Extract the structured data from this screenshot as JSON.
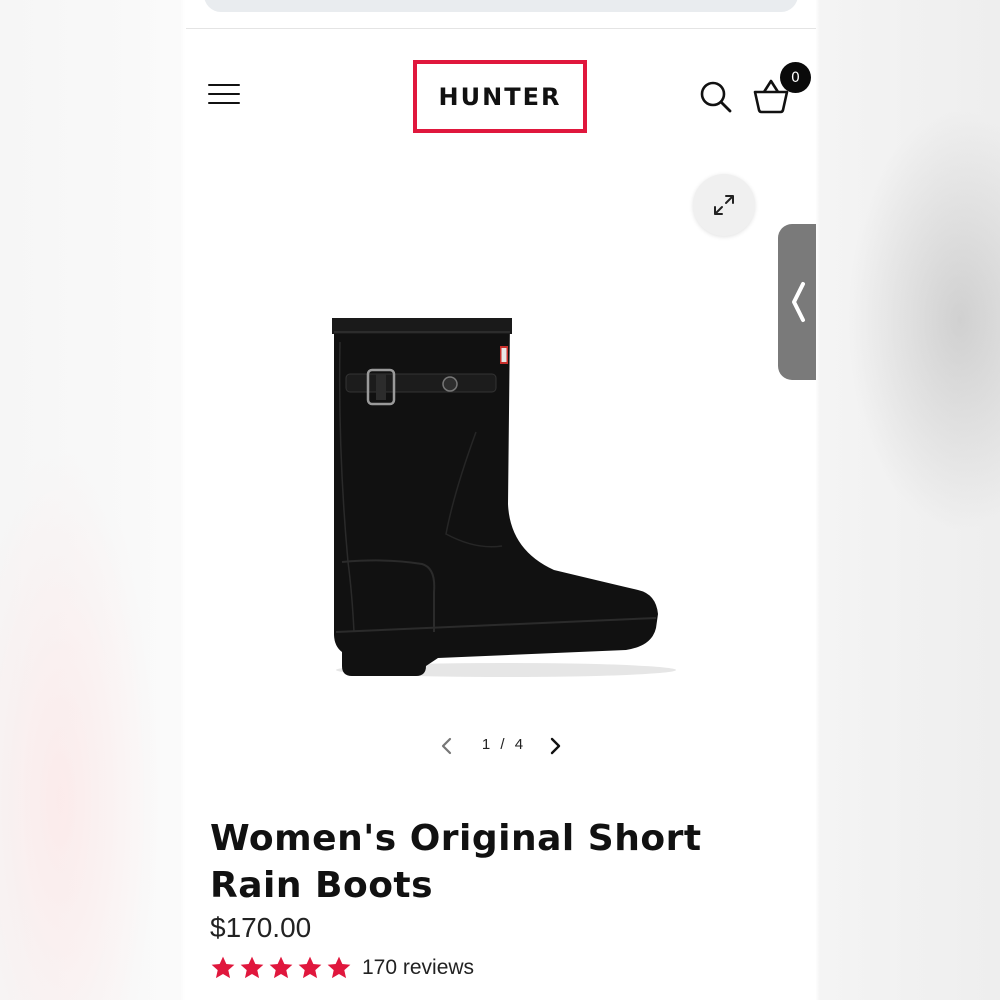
{
  "brand": {
    "logo_text": "HUNTER",
    "accent_color": "#e0173d"
  },
  "header": {
    "menu_icon": "hamburger-menu-icon",
    "search_icon": "search-icon",
    "cart_icon": "basket-icon",
    "cart_count": "0"
  },
  "gallery": {
    "expand_icon": "expand-icon",
    "side_tab_icon": "chevron-left-icon",
    "current": 1,
    "total": 4,
    "counter": "1 / 4",
    "prev_icon": "chevron-left-icon",
    "next_icon": "chevron-right-icon"
  },
  "product": {
    "title": "Women's Original Short Rain Boots",
    "price": "$170.00",
    "rating": 5,
    "reviews_label": "170 reviews",
    "star_color": "#e0173d"
  }
}
